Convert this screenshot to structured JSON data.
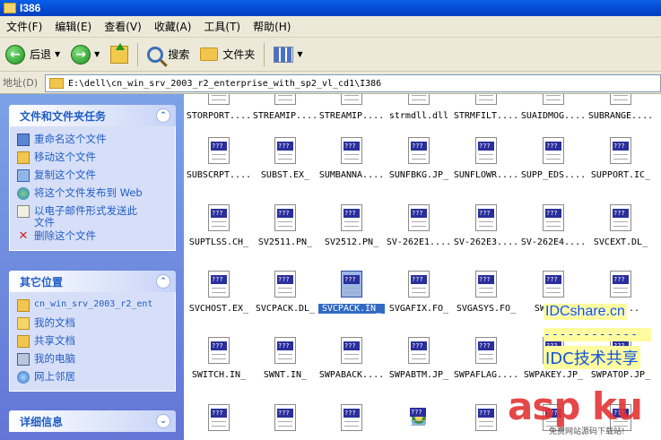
{
  "window": {
    "title": "I386"
  },
  "menu": [
    "文件(F)",
    "编辑(E)",
    "查看(V)",
    "收藏(A)",
    "工具(T)",
    "帮助(H)"
  ],
  "toolbar": {
    "back_label": "后退",
    "search_label": "搜索",
    "folders_label": "文件夹"
  },
  "address": {
    "label": "地址(D)",
    "value": "E:\\dell\\cn_win_srv_2003_r2_enterprise_with_sp2_vl_cd1\\I386"
  },
  "tasks_panel": {
    "title": "文件和文件夹任务",
    "items": [
      "重命名这个文件",
      "移动这个文件",
      "复制这个文件",
      "将这个文件发布到 Web",
      "以电子邮件形式发送此文件",
      "删除这个文件"
    ]
  },
  "places_panel": {
    "title": "其它位置",
    "items": [
      "cn_win_srv_2003_r2_ent",
      "我的文档",
      "共享文档",
      "我的电脑",
      "网上邻居"
    ]
  },
  "details_panel": {
    "title": "详细信息"
  },
  "files": [
    [
      "STORPORT....",
      "STREAMIP....",
      "STREAMIP....",
      "strmdll.dll",
      "STRMFILT....",
      "SUAIDMOG....",
      "SUBRANGE...."
    ],
    [
      "SUBSCRPT....",
      "SUBST.EX_",
      "SUMBANNA....",
      "SUNFBKG.JP_",
      "SUNFLOWR....",
      "SUPP_EDS....",
      "SUPPORT.IC_"
    ],
    [
      "SUPTLSS.CH_",
      "SV2511.PN_",
      "SV2512.PN_",
      "SV-262E1....",
      "SV-262E3....",
      "SV-262E4....",
      "SVCEXT.DL_"
    ],
    [
      "SVCHOST.EX_",
      "SVCPACK.DL_",
      "SVCPACK.IN_",
      "SVGAFIX.FO_",
      "SVGASYS.FO_",
      "SWE....",
      "SWE...."
    ],
    [
      "SWITCH.IN_",
      "SWNT.IN_",
      "SWPABACK....",
      "SWPABTM.JP_",
      "SWPAFLAG....",
      "SWPAKEY.JP_",
      "SWPATOP.JP_"
    ],
    [
      "",
      "",
      "",
      "",
      "",
      "",
      ""
    ]
  ],
  "selected_file": "SVCPACK.IN_",
  "watermarks": {
    "site": "IDCshare.cn",
    "dashes": "------------",
    "cn": "IDC技术共享",
    "asp": "asp ku",
    "asp_sub": "免费网站源码下载站!"
  }
}
